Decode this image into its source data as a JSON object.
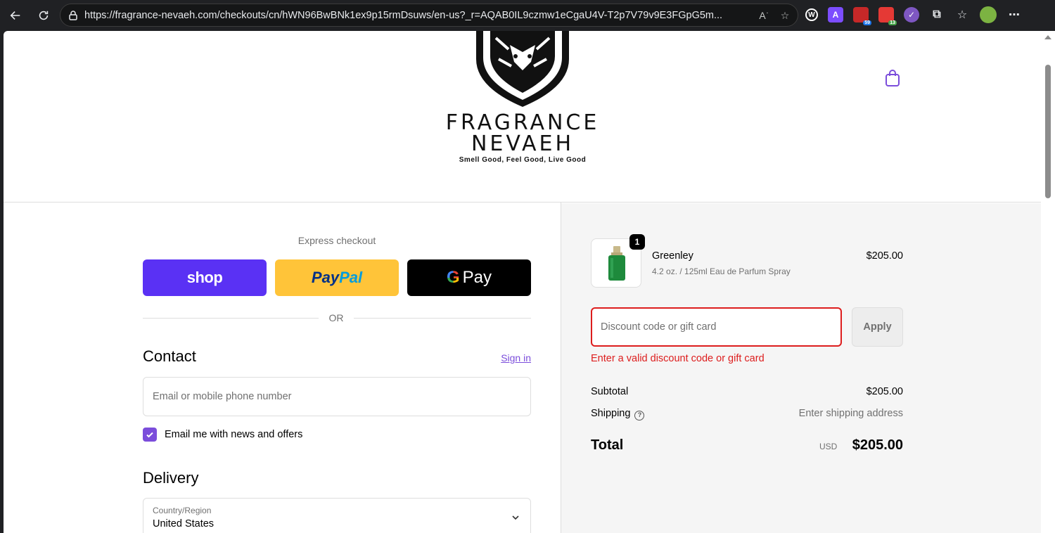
{
  "browser": {
    "url": "https://fragrance-nevaeh.com/checkouts/cn/hWN96BwBNk1ex9p15rmDsuws/en-us?_r=AQAB0IL9czmw1eCgaU4V-T2p7V79v9E3FGpG5m...",
    "extensions": [
      {
        "name": "wikiwand-icon",
        "letter": "W",
        "bg": "#202124",
        "color": "#ffffff"
      },
      {
        "name": "a-extension-icon",
        "letter": "A",
        "bg": "#7c4dff",
        "color": "#ffffff"
      },
      {
        "name": "calendar-extension-icon",
        "letter": "",
        "badge": "59",
        "bg": "#d32f2f",
        "color": "#ffffff"
      },
      {
        "name": "todo-extension-icon",
        "letter": "",
        "badge": "13",
        "bg": "#e53935",
        "color": "#ffffff"
      },
      {
        "name": "purple-extension-icon",
        "letter": "",
        "bg": "#7e57c2",
        "color": "#ffffff"
      }
    ]
  },
  "brand": {
    "line1": "FRAGRANCE",
    "line2": "NEVAEH",
    "tagline": "Smell Good, Feel Good, Live Good"
  },
  "express": {
    "label": "Express checkout",
    "shop": "shop",
    "paypal_a": "Pay",
    "paypal_b": "Pal",
    "gpay_g": "G",
    "gpay": "Pay",
    "or": "OR"
  },
  "contact": {
    "title": "Contact",
    "signin": "Sign in",
    "email_placeholder": "Email or mobile phone number",
    "newsletter_label": "Email me with news and offers"
  },
  "delivery": {
    "title": "Delivery",
    "country_label": "Country/Region",
    "country_value": "United States"
  },
  "order": {
    "quantity": "1",
    "product_name": "Greenley",
    "product_variant": "4.2 oz. / 125ml Eau de Parfum Spray",
    "product_price": "$205.00",
    "discount_placeholder": "Discount code or gift card",
    "apply": "Apply",
    "discount_error": "Enter a valid discount code or gift card",
    "subtotal_label": "Subtotal",
    "subtotal_value": "$205.00",
    "shipping_label": "Shipping",
    "shipping_value": "Enter shipping address",
    "total_label": "Total",
    "total_currency": "USD",
    "total_value": "$205.00"
  },
  "colors": {
    "accent": "#7b4ddb",
    "error": "#dd1d1d",
    "shop": "#5a31f4",
    "paypal": "#ffc439"
  }
}
